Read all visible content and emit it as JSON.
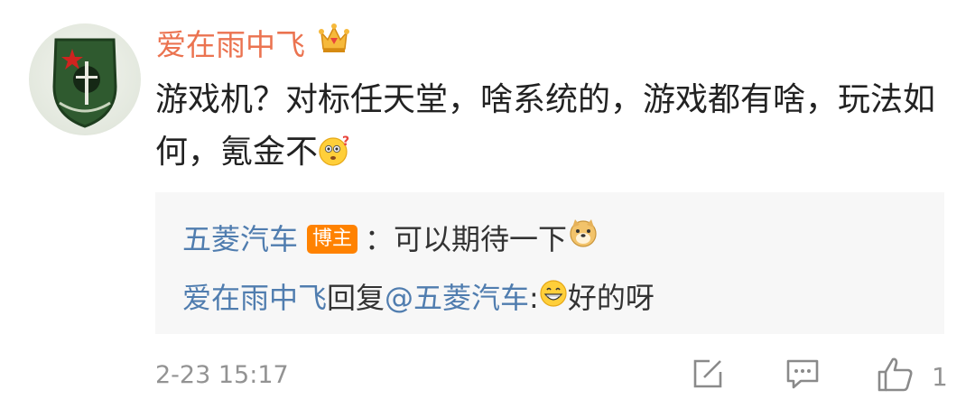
{
  "comment": {
    "username": "爱在雨中飞",
    "user_badge_icon": "crown-vip-icon",
    "text": "游戏机？对标任天堂，啥系统的，游戏都有啥，玩法如何，氪金不",
    "emoji": "question-face-icon"
  },
  "replies": [
    {
      "author": "五菱汽车",
      "badge": "博主",
      "separator": "：",
      "text": "可以期待一下",
      "emoji": "doge-icon"
    },
    {
      "author": "爱在雨中飞",
      "reply_word": "回复",
      "mention": "@五菱汽车",
      "separator": ":",
      "emoji": "grin-face-icon",
      "text": "好的呀"
    }
  ],
  "footer": {
    "timestamp": "2-23 15:17",
    "like_count": "1",
    "icons": [
      "share-edit-icon",
      "comment-icon",
      "thumbs-up-icon"
    ]
  },
  "colors": {
    "username": "#eb7350",
    "link": "#507daf",
    "badge": "#ff8200",
    "meta": "#939393",
    "reply_bg": "#f7f7f7"
  }
}
